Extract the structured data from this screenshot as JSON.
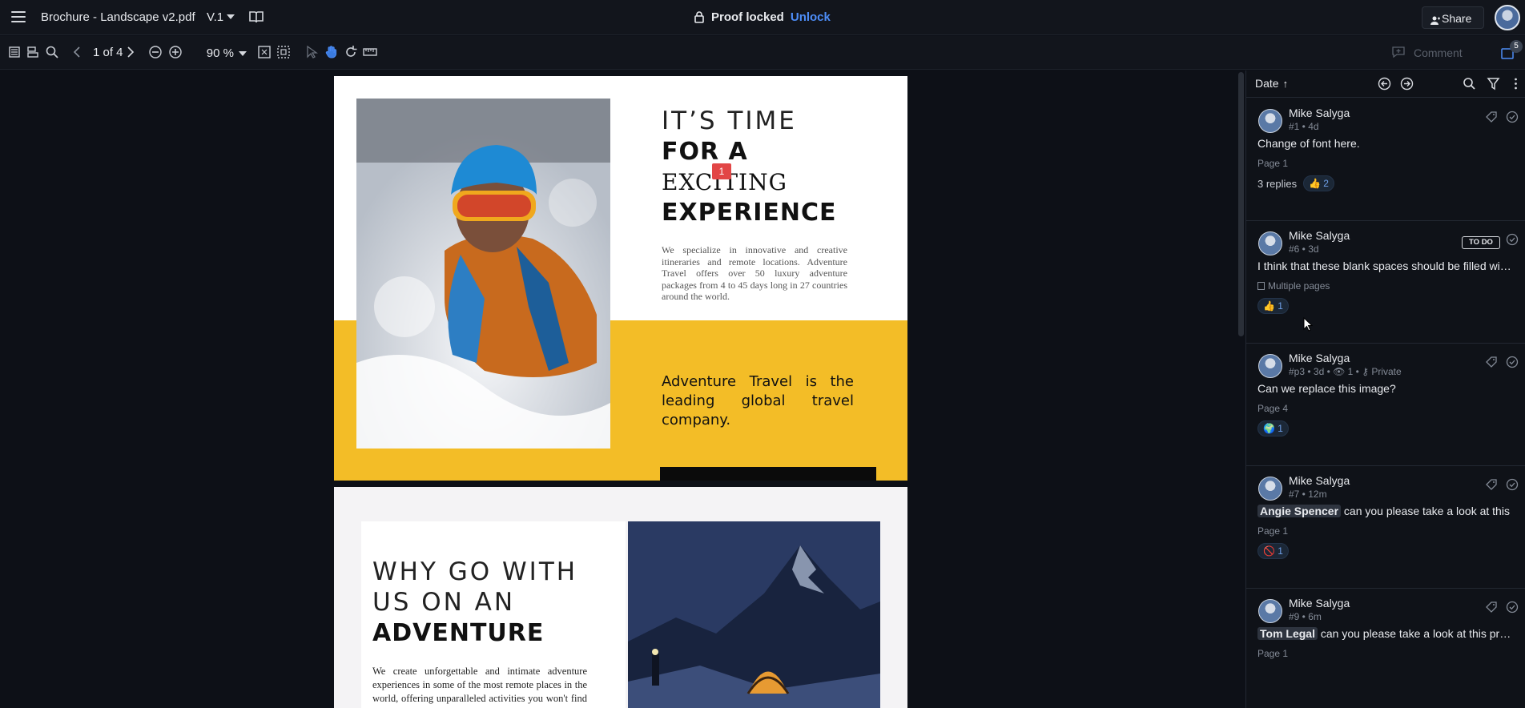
{
  "header": {
    "file_title": "Brochure - Landscape v2.pdf",
    "version": "V.1",
    "proof_status": "Proof locked",
    "unlock_label": "Unlock",
    "share_label": "Share"
  },
  "toolbar": {
    "page_indicator": "1 of 4",
    "zoom": "90 %",
    "comment_label": "Comment",
    "comment_count": "5"
  },
  "document": {
    "page1": {
      "heading_line1": "IT’S TIME",
      "heading_line2": "FOR A",
      "heading_line3": "EXCITING",
      "heading_line4": "EXPERIENCE",
      "body": "We specialize in innovative and creative itineraries and remote locations. Adventure Travel offers over 50 luxury adventure packages from 4 to 45 days long in 27 countries around the world.",
      "tagline": "Adventure Travel is the leading global travel company.",
      "annotation_pin": "1"
    },
    "page2": {
      "heading_line1": "WHY GO WITH",
      "heading_line2": "US ON AN",
      "heading_line3": "ADVENTURE",
      "body": "We create unforgettable and intimate adventure experiences in some of the most remote places in the world, offering unparalleled activities you won't find elsewhere."
    }
  },
  "panel": {
    "sort_label": "Date",
    "comments": [
      {
        "author": "Mike Salyga",
        "meta": "#1 • 4d",
        "text": "Change of font here.",
        "page": "Page 1",
        "replies": "3 replies",
        "reaction_count": "2",
        "status": ""
      },
      {
        "author": "Mike Salyga",
        "meta": "#6 • 3d",
        "text": "I think that these blank spaces should be filled with some content",
        "page": "Multiple pages",
        "replies": "",
        "reaction_count": "1",
        "status": "TO DO"
      },
      {
        "author": "Mike Salyga",
        "meta": "#p3 • 3d • 👁 1 • ⚷ Private",
        "text": "Can we replace this image?",
        "page": "Page 4",
        "replies": "",
        "reaction_count": "1",
        "status": ""
      },
      {
        "author": "Mike Salyga",
        "meta": "#7 • 12m",
        "mention": "Angie Spencer",
        "text": "can you please take a look at this",
        "page": "Page 1",
        "replies": "",
        "reaction_count": "1",
        "status": ""
      },
      {
        "author": "Mike Salyga",
        "meta": "#9 • 6m",
        "mention": "Tom Legal",
        "text": "can you please take a look at this proof",
        "page": "Page 1",
        "replies": "",
        "reaction_count": "",
        "status": ""
      }
    ]
  },
  "colors": {
    "accent": "#4d8df7",
    "pin": "#e24646",
    "brochure_yellow": "#f3bd27"
  }
}
